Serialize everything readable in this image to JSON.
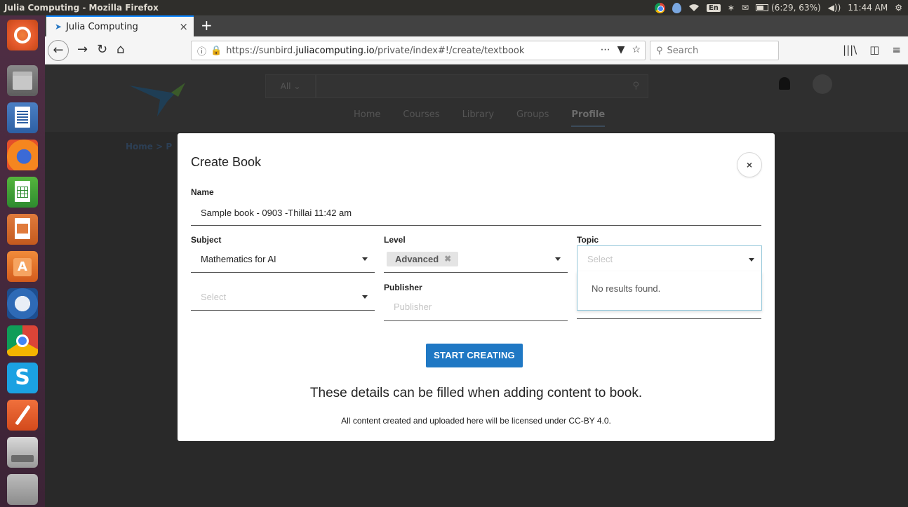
{
  "os": {
    "window_title": "Julia Computing - Mozilla Firefox",
    "battery_text": "(6:29, 63%)",
    "clock": "11:44 AM",
    "keyboard_layout": "En"
  },
  "launcher": {
    "items": [
      "ubuntu-dash",
      "files",
      "libreoffice-writer",
      "firefox",
      "libreoffice-calc",
      "libreoffice-impress",
      "ubuntu-software",
      "thunderbird",
      "chrome",
      "skype",
      "text-editor",
      "drive",
      "trash"
    ]
  },
  "browser": {
    "tab_title": "Julia Computing",
    "url_prefix": "https://sunbird.",
    "url_domain": "juliacomputing.io",
    "url_path": "/private/index#!/create/textbook",
    "search_placeholder": "Search"
  },
  "site": {
    "category": "All",
    "menu": [
      "Home",
      "Courses",
      "Library",
      "Groups",
      "Profile"
    ],
    "active_menu": "Profile",
    "breadcrumb": "Home  >  P"
  },
  "modal": {
    "title": "Create Book",
    "close_icon": "×",
    "name_label": "Name",
    "name_value": "Sample book - 0903 -Thillai 11:42 am",
    "subject_label": "Subject",
    "subject_value": "Mathematics for AI",
    "level_label": "Level",
    "level_chip": "Advanced",
    "topic_label": "Topic",
    "topic_placeholder": "Select",
    "topic_no_results": "No results found.",
    "extra_select_placeholder": "Select",
    "publisher_label": "Publisher",
    "publisher_placeholder": "Publisher",
    "start_button": "START CREATING",
    "note_big": "These details can be filled when adding content to book.",
    "note_small": "All content created and uploaded here will be licensed under CC-BY 4.0."
  },
  "colors": {
    "accent": "#1f78c4",
    "launcher": "#4f2e44",
    "top_panel": "#2f2e2b"
  }
}
